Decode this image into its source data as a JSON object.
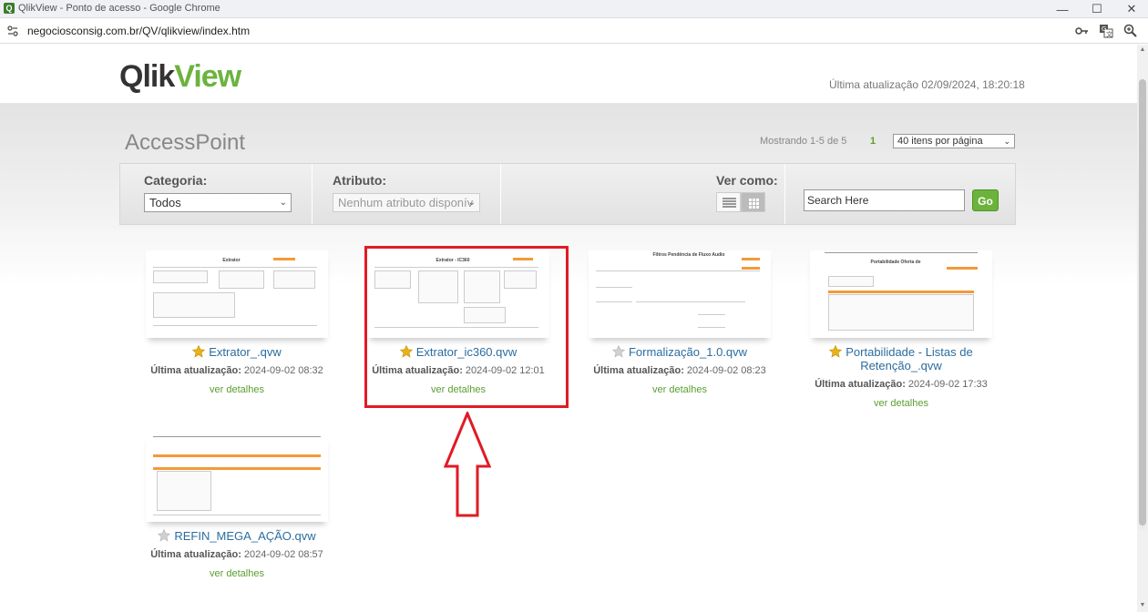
{
  "browser": {
    "window_title": "QlikView - Ponto de acesso - Google Chrome",
    "url": "negociosconsig.com.br/QV/qlikview/index.htm",
    "favicon_letter": "Q"
  },
  "header": {
    "logo_part1": "Qlik",
    "logo_part2": "View",
    "last_update": "Última atualização 02/09/2024, 18:20:18"
  },
  "toolbar": {
    "title": "AccessPoint",
    "showing": "Mostrando 1-5 de 5",
    "page": "1",
    "per_page": "40 itens por página"
  },
  "filters": {
    "category_label": "Categoria:",
    "category_value": "Todos",
    "attribute_label": "Atributo:",
    "attribute_value": "Nenhum atributo disponív",
    "view_label": "Ver como:",
    "search_placeholder": "Search Here",
    "go_label": "Go"
  },
  "documents": [
    {
      "name": "Extrator_.qvw",
      "update_label": "Última atualização:",
      "update_value": "2024-09-02 08:32",
      "details": "ver detalhes",
      "favorite": true,
      "thumb_title": "Extrator"
    },
    {
      "name": "Extrator_ic360.qvw",
      "update_label": "Última atualização:",
      "update_value": "2024-09-02 12:01",
      "details": "ver detalhes",
      "favorite": true,
      "thumb_title": "Extrator - IC360"
    },
    {
      "name": "Formalização_1.0.qvw",
      "update_label": "Última atualização:",
      "update_value": "2024-09-02 08:23",
      "details": "ver detalhes",
      "favorite": false,
      "thumb_title": "Filtros Pendência de Fluxo Audio"
    },
    {
      "name": "Portabilidade - Listas de Retenção_.qvw",
      "update_label": "Última atualização:",
      "update_value": "2024-09-02 17:33",
      "details": "ver detalhes",
      "favorite": true,
      "thumb_title": "Portabilidade Oferta de"
    },
    {
      "name": "REFIN_MEGA_AÇÃO.qvw",
      "update_label": "Última atualização:",
      "update_value": "2024-09-02 08:57",
      "details": "ver detalhes",
      "favorite": false,
      "thumb_title": ""
    }
  ],
  "colors": {
    "accent_green": "#6cb33e",
    "link_blue": "#2b6c9f",
    "highlight_red": "#e01b24",
    "thumb_orange": "#f39a3a"
  }
}
